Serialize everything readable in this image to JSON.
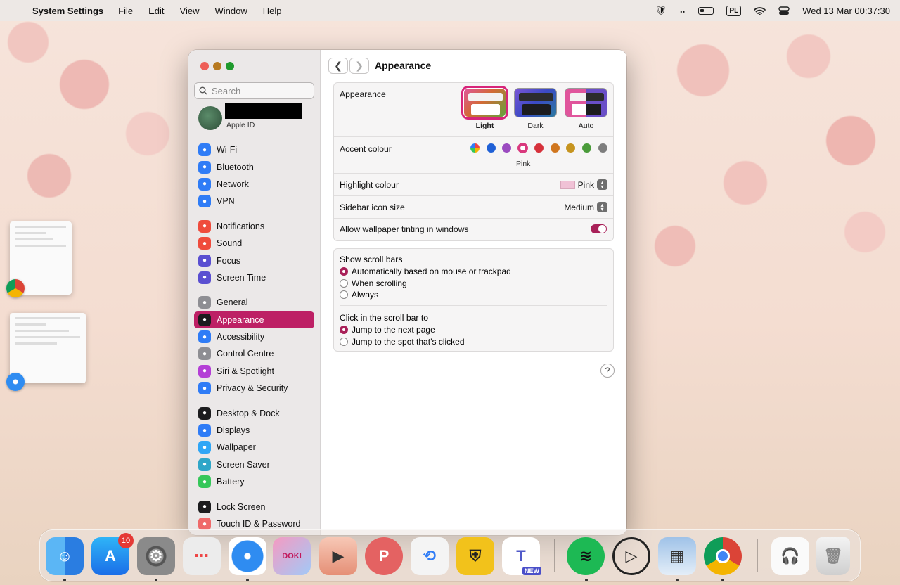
{
  "menubar": {
    "app_name": "System Settings",
    "menus": [
      "File",
      "Edit",
      "View",
      "Window",
      "Help"
    ],
    "input_source": "PL",
    "clock": "Wed 13 Mar  00:37:30"
  },
  "window": {
    "search_placeholder": "Search",
    "apple_id_label": "Apple ID",
    "sidebar": {
      "items": [
        {
          "label": "Wi-Fi",
          "icon": "wifi-icon",
          "color": "#2f7cf6"
        },
        {
          "label": "Bluetooth",
          "icon": "bluetooth-icon",
          "color": "#2f7cf6"
        },
        {
          "label": "Network",
          "icon": "globe-icon",
          "color": "#2f7cf6"
        },
        {
          "label": "VPN",
          "icon": "vpn-icon",
          "color": "#2f7cf6"
        },
        {
          "label": "Notifications",
          "icon": "bell-icon",
          "color": "#ef4b3c"
        },
        {
          "label": "Sound",
          "icon": "speaker-icon",
          "color": "#ef4b3c"
        },
        {
          "label": "Focus",
          "icon": "moon-icon",
          "color": "#5a4fd1"
        },
        {
          "label": "Screen Time",
          "icon": "hourglass-icon",
          "color": "#5a4fd1"
        },
        {
          "label": "General",
          "icon": "gear-icon",
          "color": "#8e8e93"
        },
        {
          "label": "Appearance",
          "icon": "appearance-icon",
          "color": "#1c1c1e",
          "active": true
        },
        {
          "label": "Accessibility",
          "icon": "accessibility-icon",
          "color": "#2f7cf6"
        },
        {
          "label": "Control Centre",
          "icon": "control-centre-icon",
          "color": "#8e8e93"
        },
        {
          "label": "Siri & Spotlight",
          "icon": "siri-icon",
          "color": "#b43fd6"
        },
        {
          "label": "Privacy & Security",
          "icon": "hand-icon",
          "color": "#2f7cf6"
        },
        {
          "label": "Desktop & Dock",
          "icon": "dock-icon",
          "color": "#1c1c1e"
        },
        {
          "label": "Displays",
          "icon": "sun-icon",
          "color": "#2f7cf6"
        },
        {
          "label": "Wallpaper",
          "icon": "flower-icon",
          "color": "#2fa6f6"
        },
        {
          "label": "Screen Saver",
          "icon": "screensaver-icon",
          "color": "#2fa6c8"
        },
        {
          "label": "Battery",
          "icon": "battery-icon",
          "color": "#35c759"
        },
        {
          "label": "Lock Screen",
          "icon": "lock-icon",
          "color": "#1c1c1e"
        },
        {
          "label": "Touch ID & Password",
          "icon": "fingerprint-icon",
          "color": "#ef6a6a"
        }
      ]
    },
    "main": {
      "title": "Appearance",
      "appearance": {
        "label": "Appearance",
        "options": [
          "Light",
          "Dark",
          "Auto"
        ],
        "selected": "Light"
      },
      "accent": {
        "label": "Accent colour",
        "colors": [
          "multicolour",
          "#1f60d6",
          "#9b4bc0",
          "#d9387d",
          "#d6313b",
          "#d0761e",
          "#c6941f",
          "#4a9b3a",
          "#7d7d7d"
        ],
        "selected_name": "Pink"
      },
      "highlight": {
        "label": "Highlight colour",
        "value": "Pink",
        "swatch": "#f0c2d6"
      },
      "sidebar_icon_size": {
        "label": "Sidebar icon size",
        "value": "Medium"
      },
      "wallpaper_tinting": {
        "label": "Allow wallpaper tinting in windows",
        "on": true
      },
      "scroll_bars": {
        "label": "Show scroll bars",
        "options": [
          "Automatically based on mouse or trackpad",
          "When scrolling",
          "Always"
        ],
        "selected": 0
      },
      "click_scroll": {
        "label": "Click in the scroll bar to",
        "options": [
          "Jump to the next page",
          "Jump to the spot that’s clicked"
        ],
        "selected": 0
      },
      "help": "?"
    }
  },
  "dock": {
    "apps": [
      "Finder",
      "App Store",
      "System Settings",
      "Launchpad",
      "Safari",
      "Doki Doki Literature Club",
      "Screen Recorder",
      "Pinterest",
      "Sync",
      "Notchmeister",
      "Microsoft Teams",
      "Spotify",
      "Play",
      "Preview",
      "Chrome",
      "Music Headphones",
      "Trash"
    ],
    "app_store_badge": "10",
    "teams_tag": "NEW"
  }
}
